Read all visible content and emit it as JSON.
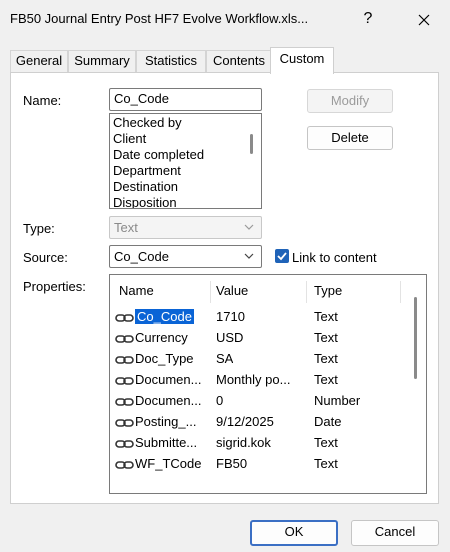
{
  "window": {
    "title": "FB50 Journal Entry Post  HF7 Evolve Workflow.xls...",
    "help": "?",
    "close": "✕"
  },
  "tabs": [
    "General",
    "Summary",
    "Statistics",
    "Contents",
    "Custom"
  ],
  "active_tab": "Custom",
  "custom": {
    "name_label": "Name:",
    "name_value": "Co_Code",
    "name_list": [
      "Checked by",
      "Client",
      "Date completed",
      "Department",
      "Destination",
      "Disposition"
    ],
    "modify_label": "Modify",
    "delete_label": "Delete",
    "type_label": "Type:",
    "type_value": "Text",
    "source_label": "Source:",
    "source_value": "Co_Code",
    "link_label": "Link to content",
    "link_checked": true,
    "properties_label": "Properties:",
    "columns": [
      "Name",
      "Value",
      "Type"
    ],
    "rows": [
      {
        "name": "Co_Code",
        "value": "1710",
        "type": "Text",
        "selected": true
      },
      {
        "name": "Currency",
        "value": "USD",
        "type": "Text"
      },
      {
        "name": "Doc_Type",
        "value": "SA",
        "type": "Text"
      },
      {
        "name": "Documen...",
        "value": "Monthly po...",
        "type": "Text"
      },
      {
        "name": "Documen...",
        "value": "0",
        "type": "Number"
      },
      {
        "name": "Posting_...",
        "value": "9/12/2025",
        "type": "Date"
      },
      {
        "name": "Submitte...",
        "value": "sigrid.kok",
        "type": "Text"
      },
      {
        "name": "WF_TCode",
        "value": "FB50",
        "type": "Text"
      }
    ]
  },
  "footer": {
    "ok": "OK",
    "cancel": "Cancel"
  },
  "colors": {
    "accent": "#1f63b8",
    "selection": "#0a64d6"
  }
}
